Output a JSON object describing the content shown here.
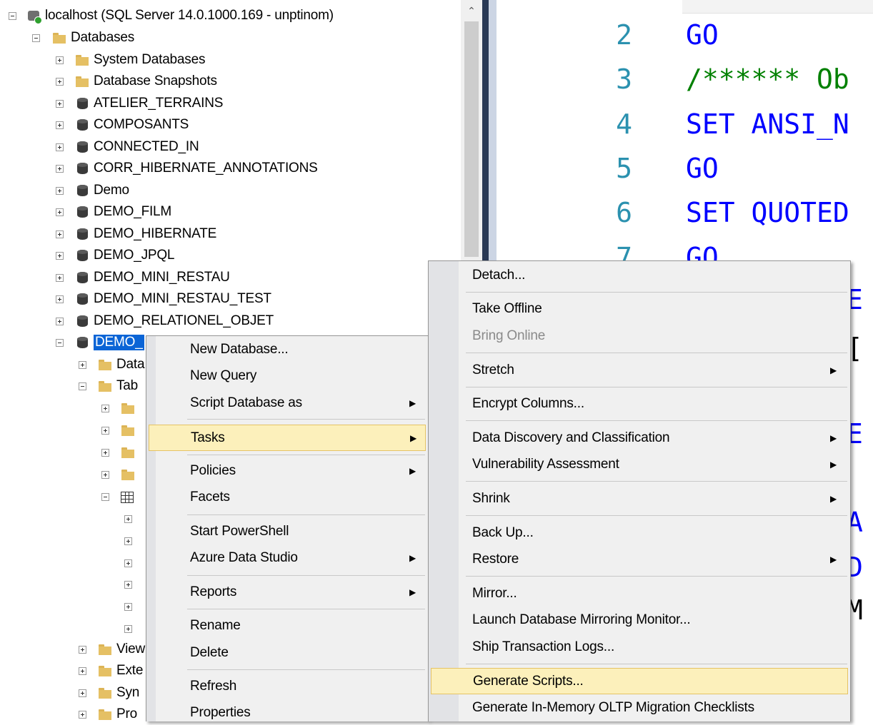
{
  "tree": {
    "server": "localhost (SQL Server 14.0.1000.169 - unptinom)",
    "databases_folder": "Databases",
    "system_databases": "System Databases",
    "database_snapshots": "Database Snapshots",
    "databases": [
      "ATELIER_TERRAINS",
      "COMPOSANTS",
      "CONNECTED_IN",
      "CORR_HIBERNATE_ANNOTATIONS",
      "Demo",
      "DEMO_FILM",
      "DEMO_HIBERNATE",
      "DEMO_JPQL",
      "DEMO_MINI_RESTAU",
      "DEMO_MINI_RESTAU_TEST",
      "DEMO_RELATIONEL_OBJET"
    ],
    "selected_db_partial": "DEMO_",
    "child_partials": {
      "diagrams": "Data",
      "tables": "Tab",
      "views": "View",
      "external": "Exte",
      "synonyms": "Syn",
      "programmability": "Pro"
    }
  },
  "editor": {
    "lines": [
      {
        "num": "2",
        "code": "GO",
        "kind": "keyword"
      },
      {
        "num": "3",
        "code": "/****** Ob",
        "kind": "comment"
      },
      {
        "num": "4",
        "code": "SET ANSI_N",
        "kind": "keyword"
      },
      {
        "num": "5",
        "code": "GO",
        "kind": "keyword"
      },
      {
        "num": "6",
        "code": "SET QUOTED",
        "kind": "keyword"
      },
      {
        "num": "7",
        "code": "GO",
        "kind": "keyword"
      }
    ],
    "fragments": [
      "E",
      "[",
      "E",
      "A",
      "D",
      "M"
    ]
  },
  "context_menu": {
    "items": {
      "new_database": "New Database...",
      "new_query": "New Query",
      "script_database_as": "Script Database as",
      "tasks": "Tasks",
      "policies": "Policies",
      "facets": "Facets",
      "start_powershell": "Start PowerShell",
      "azure_data_studio": "Azure Data Studio",
      "reports": "Reports",
      "rename": "Rename",
      "delete": "Delete",
      "refresh": "Refresh",
      "properties": "Properties"
    }
  },
  "tasks_menu": {
    "items": {
      "detach": "Detach...",
      "take_offline": "Take Offline",
      "bring_online": "Bring Online",
      "stretch": "Stretch",
      "encrypt_columns": "Encrypt Columns...",
      "data_discovery": "Data Discovery and Classification",
      "vulnerability": "Vulnerability Assessment",
      "shrink": "Shrink",
      "back_up": "Back Up...",
      "restore": "Restore",
      "mirror": "Mirror...",
      "launch_mirroring": "Launch Database Mirroring Monitor...",
      "ship_logs": "Ship Transaction Logs...",
      "generate_scripts": "Generate Scripts...",
      "generate_inmemory": "Generate In-Memory OLTP Migration Checklists"
    }
  },
  "colors": {
    "selection": "#0a64d6",
    "menu_highlight": "#fcf0bb",
    "keyword": "#0000ff",
    "comment": "#008000",
    "line_number": "#2b91af"
  }
}
